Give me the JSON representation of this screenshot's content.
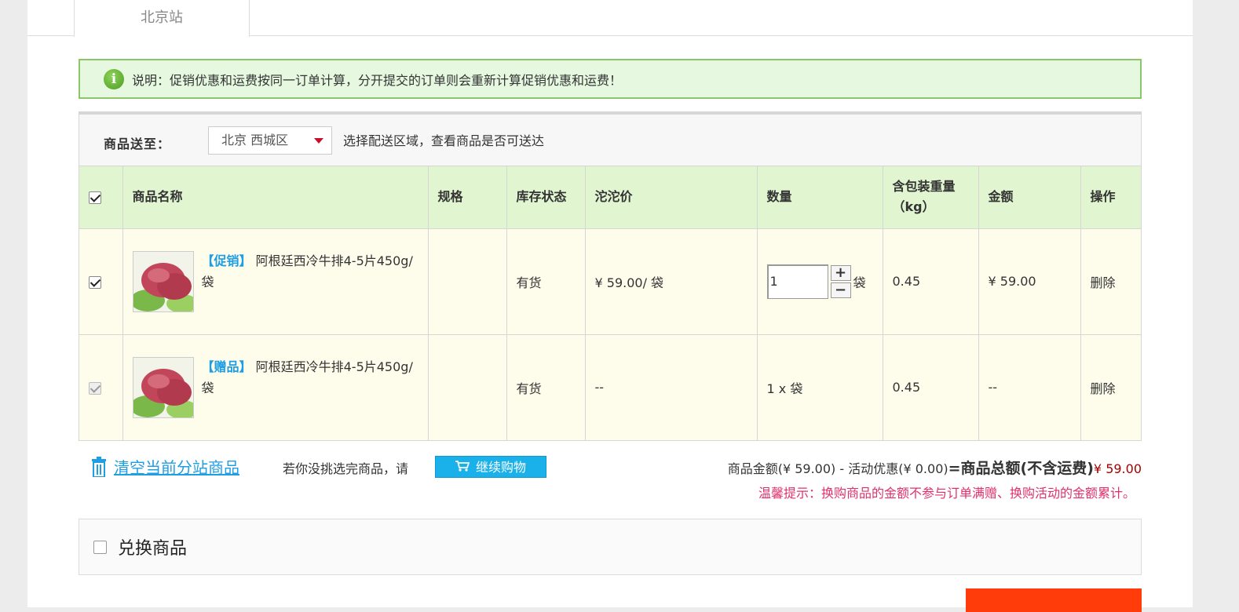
{
  "station_tab": "北京站",
  "notice": {
    "icon": "info-icon",
    "text": "说明：促销优惠和运费按同一订单计算，分开提交的订单则会重新计算促销优惠和运费！"
  },
  "shipping": {
    "label": "商品送至：",
    "region": "北京 西城区",
    "hint": "选择配送区域，查看商品是否可送达"
  },
  "table": {
    "headers": {
      "name": "商品名称",
      "spec": "规格",
      "stock": "库存状态",
      "price": "沱沱价",
      "qty": "数量",
      "weight": "含包装重量（kg）",
      "amount": "金额",
      "action": "操作"
    },
    "rows": [
      {
        "tag": "【促销】",
        "name": "阿根廷西冷牛排4-5片450g/袋",
        "spec": "",
        "stock": "有货",
        "price": "¥ 59.00/ 袋",
        "qty": "1",
        "unit": "袋",
        "weight": "0.45",
        "amount": "¥ 59.00",
        "action": "删除"
      },
      {
        "tag": "【赠品】",
        "name": "阿根廷西冷牛排4-5片450g/袋",
        "spec": "",
        "stock": "有货",
        "price": "--",
        "qty_text": "1 x 袋",
        "weight": "0.45",
        "amount": "--",
        "action": "删除"
      }
    ]
  },
  "actions": {
    "clear": "清空当前分站商品",
    "more_hint": "若你没挑选完商品，请",
    "continue": "继续购物"
  },
  "summary": {
    "goods": "商品金额(¥ 59.00)",
    "minus": " - ",
    "discount": "活动优惠(¥ 0.00)",
    "equals": "=",
    "total_label": "商品总额(不含运费)",
    "total": "¥ 59.00",
    "tip": "温馨提示：换购商品的金额不参与订单满赠、换购活动的金额累计。"
  },
  "exchange": {
    "label": "兑换商品"
  },
  "colors": {
    "accent_blue": "#1f9ee3",
    "notice_bg": "#e6f8e0",
    "header_bg": "#e0f5d0",
    "checkout": "#ff3c0a"
  }
}
